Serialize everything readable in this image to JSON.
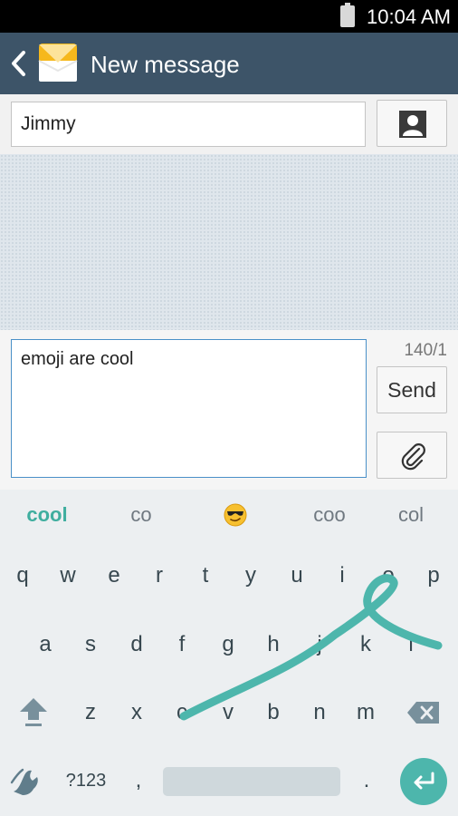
{
  "status_bar": {
    "time": "10:04 AM"
  },
  "action_bar": {
    "title": "New message",
    "back_icon": "chevron-left-icon",
    "app_icon": "envelope-icon"
  },
  "recipient": {
    "value": "Jimmy",
    "contact_icon": "contact-icon"
  },
  "compose": {
    "message": "emoji are cool",
    "counter": "140/1",
    "send_label": "Send",
    "attach_icon": "paperclip-icon"
  },
  "suggestions": {
    "items": [
      "cool",
      "co",
      "coo",
      "col"
    ],
    "emoji": "sunglasses-emoji-icon"
  },
  "keyboard": {
    "row1": [
      "q",
      "w",
      "e",
      "r",
      "t",
      "y",
      "u",
      "i",
      "o",
      "p"
    ],
    "row2": [
      "a",
      "s",
      "d",
      "f",
      "g",
      "h",
      "j",
      "k",
      "l"
    ],
    "row3": [
      "z",
      "x",
      "c",
      "v",
      "b",
      "n",
      "m"
    ],
    "symbols_label": "?123",
    "comma": ",",
    "period": ".",
    "swipe_trail_color": "#4db6ac"
  },
  "colors": {
    "action_bar": "#3d5468",
    "accent": "#4db6ac",
    "focus_border": "#4a90c8"
  }
}
